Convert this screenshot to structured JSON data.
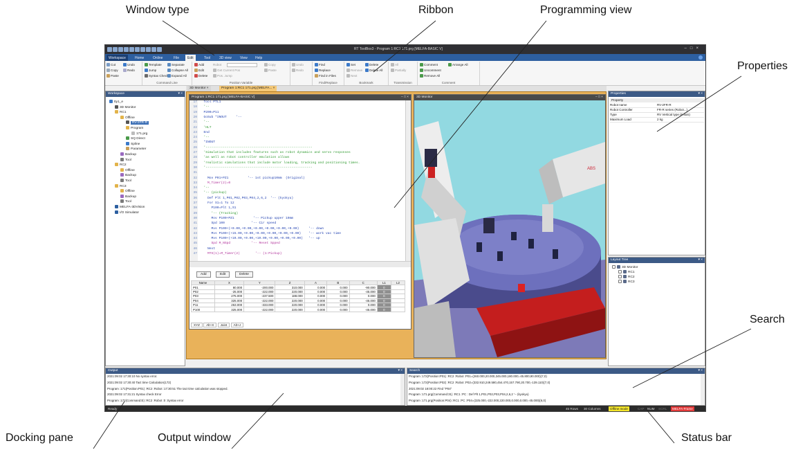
{
  "callouts": {
    "window_type": "Window type",
    "ribbon": "Ribbon",
    "programming_view": "Programming view",
    "properties": "Properties",
    "search": "Search",
    "docking_pane": "Docking pane",
    "output_window": "Output window",
    "status_bar": "Status bar"
  },
  "app": {
    "title": "RT ToolBox3 - Program 1:RC1 171.prg  [MELFA-BASIC V]",
    "tabs": [
      "Workspace",
      "Home",
      "Online",
      "File",
      "Edit",
      "Tool",
      "3D view",
      "View",
      "Help"
    ],
    "active_tab": "Edit"
  },
  "ribbon": {
    "groups": {
      "clipboard": {
        "cut": "Cut",
        "copy": "Copy",
        "paste": "Paste",
        "undo": "Undo",
        "redo": "Redo"
      },
      "command_line": {
        "label": "Command Line",
        "template": "Template",
        "jump": "Jump",
        "syntax_check": "Syntax Check",
        "separate": "Separate",
        "collapse_all": "Collapse All",
        "expand_all": "Expand All"
      },
      "position_variable": {
        "label": "Position Variable",
        "add": "Add",
        "edit": "Edit",
        "delete": "Delete",
        "robot": "Robot",
        "get_current_pos": "Get Current Pos",
        "pos_jump": "Pos. Jump"
      },
      "edit2": {
        "copy": "Copy",
        "paste": "Paste",
        "undo": "Undo",
        "redo": "Redo"
      },
      "find_replace": {
        "label": "Find/Replace",
        "find": "Find",
        "replace": "Replace",
        "find_in_files": "Find in Files"
      },
      "bookmark": {
        "label": "Bookmark",
        "set": "Set",
        "delete": "Delete",
        "remove": "Remove",
        "delete_all": "Delete All",
        "next": "Next"
      },
      "transmission": {
        "label": "Transmission",
        "all": "All",
        "partially": "Partially"
      },
      "comment": {
        "label": "Comment",
        "comment": "Comment",
        "arrange_all": "Arrange All",
        "uncomment": "Uncomment",
        "remove_all": "Remove All"
      }
    }
  },
  "workspace": {
    "header": "Workspace",
    "items": [
      {
        "label": "tty1_e",
        "level": 0,
        "icon": "workspace-icon"
      },
      {
        "label": "3D Monitor",
        "level": 1,
        "icon": "monitor-icon"
      },
      {
        "label": "RC1",
        "level": 1,
        "icon": "folder-icon"
      },
      {
        "label": "Offline",
        "level": 2,
        "icon": "folder-icon"
      },
      {
        "label": "RV-2FR-R",
        "level": 3,
        "icon": "robot-icon",
        "selected": true
      },
      {
        "label": "Program",
        "level": 3,
        "icon": "folder-icon"
      },
      {
        "label": "171.prg",
        "level": 4,
        "icon": "file-icon"
      },
      {
        "label": "SQ Direct",
        "level": 3,
        "icon": "sq-icon"
      },
      {
        "label": "Spline",
        "level": 3,
        "icon": "spline-icon"
      },
      {
        "label": "Parameter",
        "level": 3,
        "icon": "param-icon"
      },
      {
        "label": "Backup",
        "level": 2,
        "icon": "backup-icon"
      },
      {
        "label": "Tool",
        "level": 2,
        "icon": "tool-icon"
      },
      {
        "label": "RC2",
        "level": 1,
        "icon": "folder-icon"
      },
      {
        "label": "Offline",
        "level": 2,
        "icon": "folder-icon"
      },
      {
        "label": "Backup",
        "level": 2,
        "icon": "backup-icon"
      },
      {
        "label": "Tool",
        "level": 2,
        "icon": "tool-icon"
      },
      {
        "label": "RC3",
        "level": 1,
        "icon": "folder-icon"
      },
      {
        "label": "Offline",
        "level": 2,
        "icon": "folder-icon"
      },
      {
        "label": "Backup",
        "level": 2,
        "icon": "backup-icon"
      },
      {
        "label": "Tool",
        "level": 2,
        "icon": "tool-icon"
      },
      {
        "label": "MELFA-3DVision",
        "level": 1,
        "icon": "vision-icon"
      },
      {
        "label": "I/O Simulator",
        "level": 1,
        "icon": "io-icon"
      }
    ]
  },
  "doc_tabs": [
    "3D Monitor",
    "Program 1:RC1 171.prg  [MELFA..."
  ],
  "program": {
    "title": "Program 1:RC1 171.prg  [MELFA-BASIC V]",
    "lines": [
      {
        "n": "17",
        "t": "  Tool PTL1"
      },
      {
        "n": "18",
        "t": "  '--"
      },
      {
        "n": "19",
        "t": "  P200=P11"
      },
      {
        "n": "20",
        "t": "  GoSub *INOUT     '--"
      },
      {
        "n": "21",
        "t": "  '--"
      },
      {
        "n": "22",
        "t": "  'HLT"
      },
      {
        "n": "23",
        "t": "  End"
      },
      {
        "n": "24",
        "t": "  '--"
      },
      {
        "n": "25",
        "t": "  *INOUT"
      },
      {
        "n": "26",
        "t": "  '--------------------------------------------------------"
      },
      {
        "n": "27",
        "t": "  'Simulation that includes features such as robot dynamics and servo responses"
      },
      {
        "n": "28",
        "t": "  'as well as robot controller emulation allows"
      },
      {
        "n": "29",
        "t": "  'realistic simulations that include motor loading, tracking and positioning times."
      },
      {
        "n": "30",
        "t": "  '--------------------------------------------------------"
      },
      {
        "n": "31",
        "t": ""
      },
      {
        "n": "32",
        "t": "    Mov P01+PZ1          '-- 1st pickup10mm  (Original)"
      },
      {
        "n": "33",
        "t": "    M_Timer(2)=0"
      },
      {
        "n": "34",
        "t": "  '--"
      },
      {
        "n": "35",
        "t": "  '-- (pickup)"
      },
      {
        "n": "36",
        "t": "    Def Plt 1,P01,P02,P03,P04,2,6,2  '-- (kyokyu)"
      },
      {
        "n": "37",
        "t": "    For S1=1 To 12"
      },
      {
        "n": "38",
        "t": "      P100=Plt 1,S1"
      },
      {
        "n": "39",
        "t": "      '-- (Tracking)"
      },
      {
        "n": "40",
        "t": "      Mov P100+PZ1          '-- Pickup upper 10mm"
      },
      {
        "n": "41",
        "t": "      Spd 100              '-- Cir speed"
      },
      {
        "n": "42",
        "t": "      Mvs P100+(+0.00,+0.00,+0.00,+0.00,+0.00,+0.00)     '-- down"
      },
      {
        "n": "43",
        "t": "      Mvs P100+(+15.00,+0.00,+0.00,+0.00,+0.00,+0.00)    '-- work vac time"
      },
      {
        "n": "44",
        "t": "      Mvs P100+(+10.00,+0.00,+10.00,+0.00,+0.00,+0.00)   '-- up"
      },
      {
        "n": "45",
        "t": "      Spd M_NSpd           '-- Reset Spped"
      },
      {
        "n": "46",
        "t": "    Next"
      },
      {
        "n": "47",
        "t": "    MTS(1)=M_Timer(2)        '-- (1:Pickup)"
      }
    ],
    "buttons": {
      "add": "Add",
      "edit": "Edit",
      "delete": "Delete"
    },
    "table": {
      "columns": [
        "Name",
        "X",
        "Y",
        "Z",
        "A",
        "B",
        "C",
        "L1",
        "L2"
      ],
      "rows": [
        [
          "P01",
          "80.000",
          "-200.000",
          "310.000",
          "0.000",
          "0.000",
          "-90.000",
          "0",
          ""
        ],
        [
          "P02",
          "-25.000",
          "-222.000",
          "220.000",
          "0.000",
          "0.000",
          "-45.000",
          "0",
          ""
        ],
        [
          "P03",
          "275.000",
          "-237.500",
          "188.000",
          "0.000",
          "0.000",
          "0.000",
          "0",
          ""
        ],
        [
          "P04",
          "325.000",
          "-222.000",
          "220.000",
          "0.000",
          "0.000",
          "-45.000",
          "0",
          ""
        ],
        [
          "P11",
          "263.000",
          "-333.000",
          "220.000",
          "0.000",
          "0.000",
          "0.000",
          "0",
          ""
        ],
        [
          "P100",
          "325.000",
          "-222.000",
          "220.000",
          "0.000",
          "0.000",
          "-45.000",
          "0",
          ""
        ]
      ]
    },
    "table_tabs": [
      "XYZ",
      "Alt+X",
      "Joint",
      "Alt+J"
    ]
  },
  "monitor": {
    "title": "3D Monitor",
    "logo_text": "ABS"
  },
  "properties": {
    "header": "Properties",
    "col_header": "Property",
    "rows": [
      [
        "Robot name",
        "RV-2FR-R"
      ],
      [
        "Robot Controller",
        "FR-R series (Robot...)"
      ],
      [
        "Type",
        "RV Vertical type (6 axis)"
      ],
      [
        "Maximum Load",
        "2 kg"
      ]
    ]
  },
  "layout_tree": {
    "header": "Layout Tree",
    "items": [
      "3D Monitor",
      "RC1",
      "RC2",
      "RC3"
    ]
  },
  "output": {
    "header": "Output",
    "lines": [
      "2021:09:02 17:30:10  No syntax error.",
      "2021:09:02 17:30:40  Tact time Calculation(172)",
      "    Program  :171(Position:P01)  :RC2   :Robot :17:30:51  The tact time calculation was stopped.",
      "2021:09:02 17:31:21  Syntax check Error",
      "    Program  :172(Command:E)    :RC2   :Robot :0   :Syntax error"
    ]
  },
  "search": {
    "header": "Search",
    "lines": [
      "    Program  :172(Position:P01)   :RC2   :Robot :P01=(260.000,20.000,345.000,180.000,-45.800,90.000)(7,0)",
      "    Program  :172(Position:P02)   :RC2   :Robot :P02=(332.910,249.580,454.470,157.790,20.700,-139.110)(7,0)",
      "2021:09:02 18:00:22  Find \"P04\"",
      "    Program  :171.prg(Command:31)   :RC1   :PC :  Def Plt 1,P01,P02,P03,P04,2,6,2 '-- (kyokyu)",
      "    Program  :171.prg(Position:P04)   :RC1   :PC :P04=(325.000,-222.000,220.000,0.000,0.000,-45.000)(6,0)"
    ]
  },
  "statusbar": {
    "left": "Ready",
    "rows": "45 Rows",
    "columns": "30 Columns",
    "mode": "Offline mode",
    "cap": "CAP",
    "num": "NUM",
    "scrl": "SCRL",
    "lang": "MELFA-Frame"
  },
  "colors": {
    "accent_blue": "#2d5fa0",
    "doc_border_orange": "#e9b25a",
    "offline_badge": "#f3e52a",
    "lang_badge": "#e23a3a",
    "sim_sky": "#8fd8e0",
    "robot_table_purple": "#5a5ea8"
  }
}
